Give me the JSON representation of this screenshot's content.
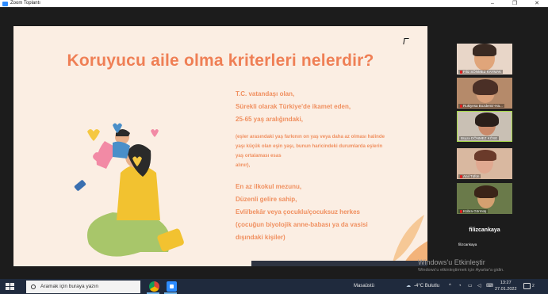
{
  "window": {
    "title": "Zoom Toplantı",
    "controls": [
      "–",
      "❐",
      "✕"
    ]
  },
  "slide": {
    "title": "Koruyucu aile olma kriterleri nelerdir?",
    "lines_a": [
      "T.C. vatandaşı olan,",
      "Sürekli olarak Türkiye'de ikamet eden,",
      "25-65 yaş aralığındaki,"
    ],
    "lines_b": [
      "(eşler arasındaki yaş farkının on yaş veya daha az olması halinde",
      "yaşı küçük olan eşin yaşı, bunun haricindeki durumlarda eşlerin",
      "yaş ortalaması esas",
      "alınır),"
    ],
    "lines_c": [
      "En az ilkokul mezunu,",
      "Düzenli gelire sahip,",
      "Evli/bekâr veya çocuklu/çocuksuz herkes",
      "(çocuğun biyolojik anne-babası ya da vasisi",
      "dışındaki kişiler)"
    ]
  },
  "participants": [
    {
      "name": "Filiz SÖNMEZ KAYMAK",
      "muted": true
    },
    {
      "name": "Rukiyesa Bozdemir-Ha...",
      "muted": true
    },
    {
      "name": "Büşra DÖNMEZ KÖSE",
      "muted": false,
      "active": true
    },
    {
      "name": "Anıl Tüfün",
      "muted": true
    },
    {
      "name": "Kübra Görmüş",
      "muted": true
    }
  ],
  "self_view": {
    "display_name": "filizcankaya",
    "label": "filizcankaya"
  },
  "activation": {
    "line1": "Windows'u Etkinleştir",
    "line2": "Windows'u etkinleştirmek için Ayarlar'a gidin."
  },
  "taskbar": {
    "search_placeholder": "Aramak için buraya yazın",
    "desktop_label": "Masaüstü",
    "weather": "-4°C Bulutlu",
    "time": "13:27",
    "date": "27.01.2022",
    "notif_count": "2"
  }
}
